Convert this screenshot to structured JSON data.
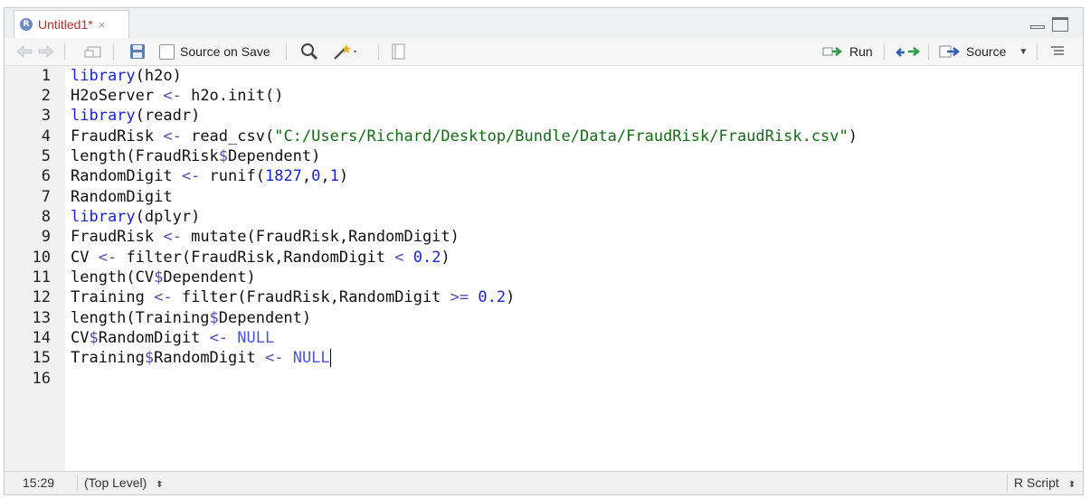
{
  "tab": {
    "title": "Untitled1*",
    "close": "×"
  },
  "toolbar": {
    "source_on_save": "Source on Save",
    "run": "Run",
    "source": "Source"
  },
  "editor": {
    "line_numbers": [
      "1",
      "2",
      "3",
      "4",
      "5",
      "6",
      "7",
      "8",
      "9",
      "10",
      "11",
      "12",
      "13",
      "14",
      "15",
      "16"
    ]
  },
  "status": {
    "position": "15:29",
    "scope": "(Top Level)",
    "filetype": "R Script"
  },
  "colors": {
    "keyword": "#1a24c9",
    "string": "#146b14",
    "tab_title": "#b0352c",
    "run_arrow": "#2f9b45"
  }
}
